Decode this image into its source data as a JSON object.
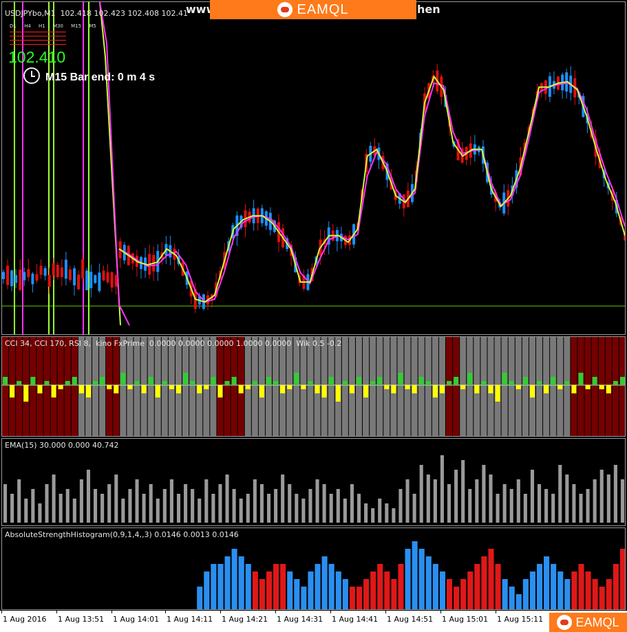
{
  "banner": {
    "brand": "EAMQL",
    "url_left": "www",
    "url_right": "hen"
  },
  "main_chart": {
    "symbol_line": "USDJPYbo,M1  102.418 102.423 102.408 102.41",
    "timeframes": [
      "D1",
      "H4",
      "H1",
      "M30",
      "M15",
      "M5"
    ],
    "legend_labels": [
      "MACD",
      "RSI",
      "CCI",
      "EMA"
    ],
    "price": "102.410",
    "bar_end_text": "M15 Bar end: 0 m 4 s"
  },
  "cci_panel": {
    "title": "CCI 34, CCI 170, RSI 8,  kino FxPrime  0.0000 0.0000 0.0000 1.0000 0.0000  Wik 0.5 -0.2"
  },
  "ema_panel": {
    "title": "EMA(15) 30.000 0.000 40.742"
  },
  "ash_panel": {
    "title": "AbsoluteStrengthHistogram(0,9,1,4,,3) 0.0146 0.0013 0.0146"
  },
  "x_axis": {
    "labels": [
      "1 Aug 2016",
      "1 Aug 13:51",
      "1 Aug 14:01",
      "1 Aug 14:11",
      "1 Aug 14:21",
      "1 Aug 14:31",
      "1 Aug 14:41",
      "1 Aug 14:51",
      "1 Aug 15:01",
      "1 Aug 15:11"
    ]
  },
  "footer": {
    "brand": "EAMQL"
  },
  "colors": {
    "bull": "#1e90ff",
    "bear": "#e01010",
    "ma_fast": "#ccff33",
    "ma_slow": "#ff33ff",
    "cci_pos": "#33cc33",
    "cci_neg": "#ffff00",
    "zone_red": "#7a0000",
    "zone_gray": "#808080",
    "ash_blue": "#2a8ff0",
    "ash_red": "#e01818",
    "price_green": "#22ff22"
  },
  "chart_data": [
    {
      "type": "line",
      "series": [
        {
          "values": [
            102.43,
            102.425,
            102.42,
            102.418,
            102.42,
            102.43,
            102.425,
            102.41,
            102.392,
            102.39,
            102.395,
            102.42,
            102.445,
            102.452,
            102.455,
            102.455,
            102.45,
            102.44,
            102.43,
            102.405,
            102.405,
            102.43,
            102.44,
            102.44,
            102.435,
            102.445,
            102.5,
            102.505,
            102.49,
            102.47,
            102.465,
            102.475,
            102.54,
            102.56,
            102.55,
            102.51,
            102.5,
            102.505,
            102.505,
            102.475,
            102.462,
            102.47,
            102.49,
            102.52,
            102.552,
            102.552,
            102.555,
            102.556,
            102.55,
            102.53,
            102.505,
            102.482,
            102.465,
            102.44
          ]
        },
        {
          "values": [
            102.43,
            102.426,
            102.421,
            102.417,
            102.418,
            102.425,
            102.428,
            102.418,
            102.398,
            102.39,
            102.392,
            102.412,
            102.438,
            102.45,
            102.454,
            102.455,
            102.452,
            102.443,
            102.432,
            102.412,
            102.404,
            102.422,
            102.437,
            102.44,
            102.437,
            102.441,
            102.485,
            102.503,
            102.494,
            102.475,
            102.466,
            102.472,
            102.53,
            102.555,
            102.553,
            102.518,
            102.502,
            102.504,
            102.505,
            102.48,
            102.463,
            102.467,
            102.485,
            102.515,
            102.548,
            102.552,
            102.554,
            102.555,
            102.551,
            102.535,
            102.51,
            102.488,
            102.47,
            102.447
          ]
        }
      ]
    },
    {
      "type": "bar",
      "values": [
        2,
        -3,
        1,
        -4,
        2,
        -2,
        1,
        -3,
        -1,
        1,
        2,
        -2,
        -3,
        1,
        2,
        -1,
        -2,
        3,
        -1,
        1,
        -2,
        2,
        -3,
        1,
        -1,
        -2,
        3,
        1,
        -2,
        -1,
        2,
        -3,
        1,
        2,
        -2,
        -1,
        1,
        -3,
        2,
        1,
        -2,
        -1,
        3,
        -1,
        1,
        -2,
        -3,
        2,
        -4,
        1,
        -2,
        2,
        -3,
        1,
        2,
        -1,
        -2,
        3,
        -1,
        -2,
        2,
        1,
        -3,
        -2,
        1,
        2,
        -1,
        3,
        -2,
        1,
        -2,
        -4,
        3,
        1,
        -1,
        2,
        -3,
        1,
        -2,
        2,
        -1,
        1,
        -2,
        3,
        -1,
        2,
        -1,
        -2,
        1,
        2
      ]
    },
    {
      "type": "bar",
      "values": [
        8,
        6,
        9,
        5,
        7,
        4,
        8,
        10,
        6,
        7,
        5,
        9,
        11,
        7,
        6,
        8,
        10,
        5,
        7,
        9,
        6,
        8,
        5,
        7,
        9,
        6,
        8,
        7,
        5,
        9,
        6,
        8,
        10,
        7,
        5,
        6,
        9,
        8,
        6,
        7,
        10,
        8,
        6,
        5,
        7,
        9,
        8,
        6,
        7,
        5,
        8,
        6,
        4,
        3,
        5,
        4,
        3,
        7,
        9,
        6,
        12,
        10,
        9,
        14,
        8,
        11,
        13,
        7,
        9,
        12,
        10,
        6,
        8,
        7,
        9,
        6,
        11,
        8,
        7,
        6,
        12,
        10,
        8,
        6,
        7,
        9,
        11,
        10,
        12,
        9
      ]
    },
    {
      "type": "bar",
      "values": [
        0,
        0,
        0,
        0,
        0,
        0,
        0,
        0,
        0,
        0,
        0,
        0,
        0,
        0,
        0,
        0,
        0,
        0,
        0,
        0,
        0,
        0,
        0,
        0,
        0,
        0,
        0,
        0,
        3,
        5,
        6,
        6,
        7,
        8,
        7,
        6,
        5,
        4,
        5,
        6,
        6,
        5,
        4,
        3,
        5,
        6,
        7,
        6,
        5,
        4,
        3,
        3,
        4,
        5,
        6,
        5,
        4,
        6,
        8,
        9,
        8,
        7,
        6,
        5,
        4,
        3,
        4,
        5,
        6,
        7,
        8,
        6,
        4,
        3,
        2,
        4,
        5,
        6,
        7,
        6,
        5,
        4,
        5,
        6,
        5,
        4,
        3,
        4,
        6,
        8
      ]
    }
  ]
}
